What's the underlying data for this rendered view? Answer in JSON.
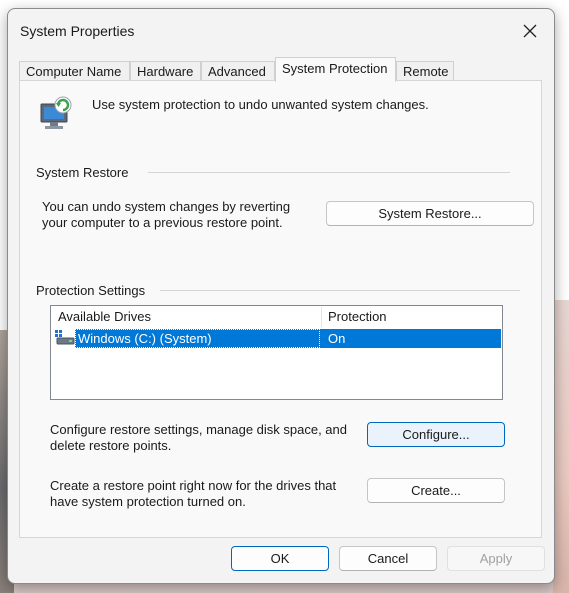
{
  "window": {
    "title": "System Properties"
  },
  "tabs": [
    {
      "label": "Computer Name"
    },
    {
      "label": "Hardware"
    },
    {
      "label": "Advanced"
    },
    {
      "label": "System Protection",
      "active": true
    },
    {
      "label": "Remote"
    }
  ],
  "intro": {
    "text": "Use system protection to undo unwanted system changes.",
    "icon": "system-protection-icon"
  },
  "system_restore": {
    "heading": "System Restore",
    "desc_line1": "You can undo system changes by reverting",
    "desc_line2": "your computer to a previous restore point.",
    "button": "System Restore..."
  },
  "protection": {
    "heading": "Protection Settings",
    "columns": [
      "Available Drives",
      "Protection"
    ],
    "rows": [
      {
        "drive": "Windows (C:) (System)",
        "protection": "On",
        "selected": true,
        "icon": "drive-icon"
      }
    ],
    "configure_line1": "Configure restore settings, manage disk space, and",
    "configure_line2": "delete restore points.",
    "configure_button": "Configure...",
    "create_line1": "Create a restore point right now for the drives that",
    "create_line2": "have system protection turned on.",
    "create_button": "Create..."
  },
  "footer": {
    "ok": "OK",
    "cancel": "Cancel",
    "apply": "Apply"
  },
  "colors": {
    "accent": "#0067c0",
    "selection": "#0078d7"
  }
}
